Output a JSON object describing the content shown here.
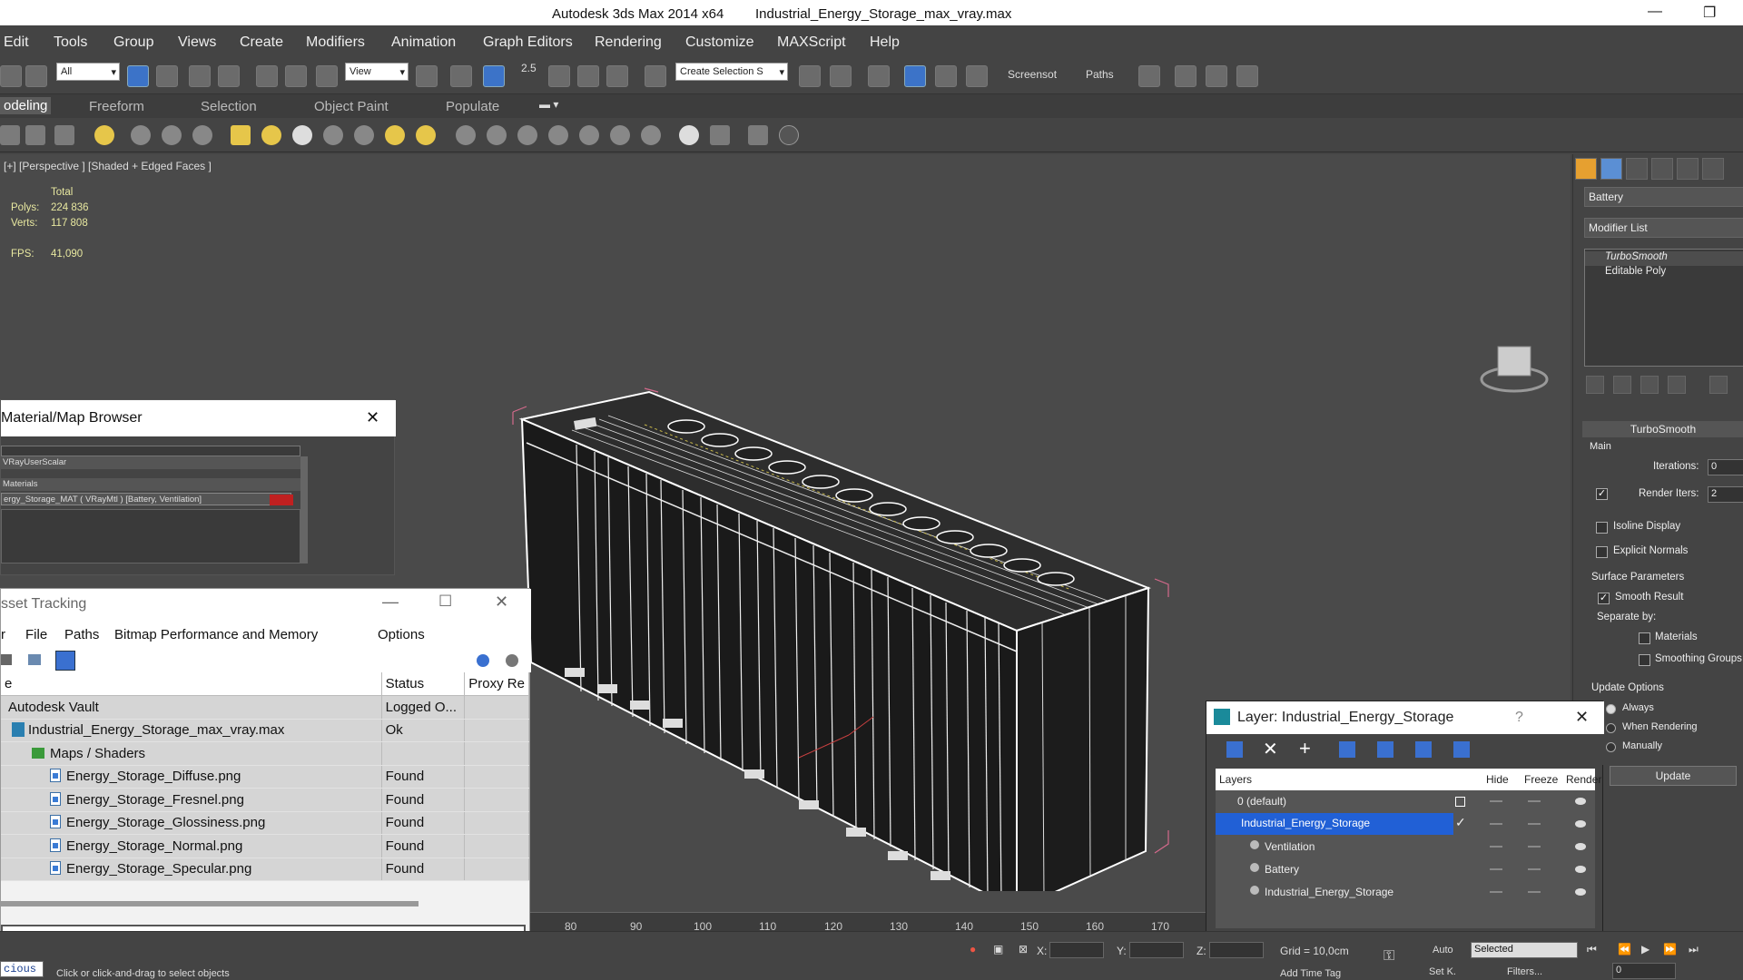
{
  "titlebar": {
    "app": "Autodesk 3ds Max  2014 x64",
    "file": "Industrial_Energy_Storage_max_vray.max",
    "minimize": "—",
    "restore": "❐"
  },
  "menu": [
    "Edit",
    "Tools",
    "Group",
    "Views",
    "Create",
    "Modifiers",
    "Animation",
    "Graph Editors",
    "Rendering",
    "Customize",
    "MAXScript",
    "Help"
  ],
  "toolbar": {
    "filter": "All",
    "ref_coord": "View",
    "selection_set": "Create Selection S",
    "snap_label": "2.5",
    "screenshot": "Screensot",
    "paths": "Paths"
  },
  "ribbon": {
    "tabs": [
      "odeling",
      "Freeform",
      "Selection",
      "Object Paint",
      "Populate"
    ]
  },
  "viewport": {
    "label": "[+] [Perspective ] [Shaded + Edged Faces ]",
    "stats": {
      "total_label": "Total",
      "polys_label": "Polys:",
      "polys": "224 836",
      "verts_label": "Verts:",
      "verts": "117 808",
      "fps_label": "FPS:",
      "fps": "41,090"
    }
  },
  "command_panel": {
    "object_name": "Battery",
    "modifier_list": "Modifier List",
    "stack": [
      "TurboSmooth",
      "Editable Poly"
    ],
    "rollout_title": "TurboSmooth",
    "main_label": "Main",
    "iterations_label": "Iterations:",
    "iterations": "0",
    "render_iters_label": "Render Iters:",
    "render_iters": "2",
    "render_iters_checked": true,
    "isoline": "Isoline Display",
    "explicit_normals": "Explicit Normals",
    "surface_params": "Surface Parameters",
    "smooth_result": "Smooth Result",
    "separate_by": "Separate by:",
    "materials": "Materials",
    "smoothing_groups": "Smoothing Groups",
    "update_options": "Update Options",
    "always": "Always",
    "when_rendering": "When Rendering",
    "manually": "Manually",
    "update_btn": "Update"
  },
  "material_browser": {
    "title": "Material/Map Browser",
    "close": "✕",
    "rows": [
      "VRayUserScalar",
      "Materials",
      "ergy_Storage_MAT ( VRayMtl ) [Battery, Ventilation]"
    ]
  },
  "asset_tracking": {
    "title": "sset Tracking",
    "menu": [
      "r",
      "File",
      "Paths",
      "Bitmap Performance and Memory",
      "Options"
    ],
    "columns": [
      "e",
      "Status",
      "Proxy Re"
    ],
    "rows": [
      {
        "name": "Autodesk Vault",
        "status": "Logged O...",
        "indent": 0,
        "icon": "vault"
      },
      {
        "name": "Industrial_Energy_Storage_max_vray.max",
        "status": "Ok",
        "indent": 1,
        "icon": "max"
      },
      {
        "name": "Maps / Shaders",
        "status": "",
        "indent": 2,
        "icon": "folder"
      },
      {
        "name": "Energy_Storage_Diffuse.png",
        "status": "Found",
        "indent": 3,
        "icon": "file"
      },
      {
        "name": "Energy_Storage_Fresnel.png",
        "status": "Found",
        "indent": 3,
        "icon": "file"
      },
      {
        "name": "Energy_Storage_Glossiness.png",
        "status": "Found",
        "indent": 3,
        "icon": "file"
      },
      {
        "name": "Energy_Storage_Normal.png",
        "status": "Found",
        "indent": 3,
        "icon": "file"
      },
      {
        "name": "Energy_Storage_Specular.png",
        "status": "Found",
        "indent": 3,
        "icon": "file"
      }
    ]
  },
  "layer_dialog": {
    "title": "Layer: Industrial_Energy_Storage",
    "help": "?",
    "close": "✕",
    "columns": [
      "Layers",
      "Hide",
      "Freeze",
      "Render"
    ],
    "rows": [
      "0 (default)",
      "Industrial_Energy_Storage",
      "Ventilation",
      "Battery",
      "Industrial_Energy_Storage"
    ]
  },
  "timeline": {
    "ticks": [
      "80",
      "90",
      "100",
      "110",
      "120",
      "130",
      "140",
      "150",
      "160",
      "170"
    ]
  },
  "status": {
    "script": "cious",
    "prompt": "Click or click-and-drag to select objects",
    "x_label": "X:",
    "y_label": "Y:",
    "z_label": "Z:",
    "grid": "Grid = 10,0cm",
    "add_time_tag": "Add Time Tag",
    "auto": "Auto",
    "selected": "Selected",
    "setk": "Set K.",
    "filters": "Filters...",
    "frame": "0"
  },
  "colors": {
    "accent": "#2160d6",
    "viewport_bg": "#4a4a4a",
    "wire": "#ffffff",
    "bbox": "#d46a8c"
  }
}
